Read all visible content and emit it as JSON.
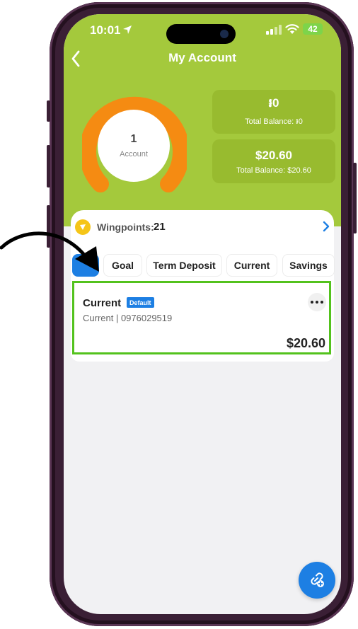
{
  "status_bar": {
    "time": "10:01",
    "battery": "42"
  },
  "header": {
    "title": "My Account"
  },
  "summary": {
    "account_count": "1",
    "account_label": "Account",
    "balances": [
      {
        "amount": "៛0",
        "label": "Total Balance: ៛0"
      },
      {
        "amount": "$20.60",
        "label": "Total Balance: $20.60"
      }
    ]
  },
  "wingpoints": {
    "label": "Wingpoints:",
    "value": "21"
  },
  "tabs": [
    {
      "label": ""
    },
    {
      "label": "Goal"
    },
    {
      "label": "Term Deposit"
    },
    {
      "label": "Current"
    },
    {
      "label": "Savings"
    }
  ],
  "account": {
    "name": "Current",
    "badge": "Default",
    "number": "Current | 0976029519",
    "amount": "$20.60"
  },
  "colors": {
    "header_green": "#a4c93c",
    "donut_orange": "#f58b12",
    "accent_blue": "#1d7fe3",
    "highlight_green": "#53c21d"
  },
  "icons": {
    "back": "chevron-left-icon",
    "wingpoints": "wingpoints-coin-icon",
    "more": "more-horizontal-icon",
    "fab": "link-plus-icon"
  }
}
